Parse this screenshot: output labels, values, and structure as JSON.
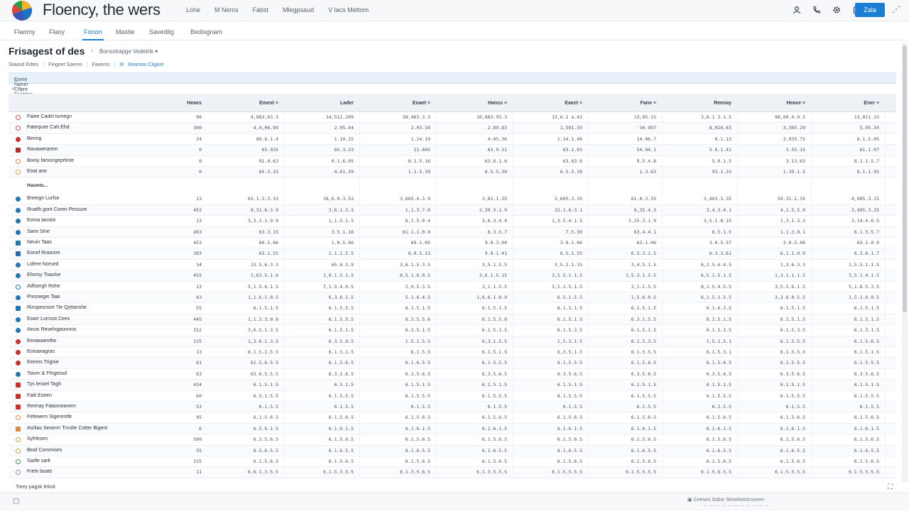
{
  "app": {
    "title": "Floency, the wers",
    "top_menu": [
      "Lohe",
      "Ṁ Nems",
      "Fabst",
      "Mlegpsaud",
      "Ṿ lacs Mettom"
    ],
    "primary_button": "Zala",
    "more_icon": "⋰"
  },
  "icons": {
    "logo": "logo-icon",
    "toolbar": [
      "user-icon",
      "phone-icon",
      "settings-icon",
      "clipboard-icon"
    ]
  },
  "nav": {
    "tabs": [
      "Flaomy",
      "Flaoy",
      "Fonon",
      "Mastie",
      "Saveditg",
      "Bedisgnam"
    ],
    "active_index": 2
  },
  "page": {
    "title": "Frisagest of des",
    "breadcrumb_select": "Bonsolrapge Vedetrik ▾",
    "subbar": [
      "Siawsd Edtes",
      "Fingeet Saeres",
      "Favems",
      "Reamos Cligent"
    ],
    "group_label": "Eome hamer Chpre Faatrtee Mhng",
    "tools": "↶ ↷",
    "section_label": "Hasmts..."
  },
  "table": {
    "columns": [
      "Heaes",
      "Emest ≡",
      "Lader",
      "Eoaet ≡",
      "Hanss ≡",
      "Eaect ≡",
      "Fane ≡",
      "Reenay",
      "Heave ≡",
      "Ener ≡"
    ],
    "group1": [
      {
        "name": "Faiee Cadel tumegn",
        "icon": "ring",
        "color": "#d9534f",
        "values": [
          "96",
          "4,983,63.3",
          "14,511.209",
          "38,463.3.3",
          "10,683.93.3",
          "13,6.1 a.42",
          "13,95.15",
          "3,6.1 2.1.5",
          "98,00.4.9.5",
          "13,011.15"
        ]
      },
      {
        "name": "Faterpuer Cah.Ehd",
        "icon": "ring",
        "color": "#d9534f",
        "values": [
          "300",
          "4,4,06.99",
          "2.05.44",
          "2.03.34",
          "2.89.83",
          "1,501.35",
          "34.997",
          "8,016.63",
          "3,395.29",
          "5,05.34"
        ]
      },
      {
        "name": "Bering",
        "icon": "dot",
        "color": "#c9302c",
        "values": [
          "34",
          "89.6.1.4",
          "1.10.15",
          "1.24.19",
          "4.05.36",
          "1.14.1.46",
          "14.06.7",
          "0.1.13",
          "3.935.75",
          "6.1.5.05"
        ]
      },
      {
        "name": "Ravawerarem",
        "icon": "sq",
        "color": "#b52b27",
        "values": [
          "0",
          "65.935",
          "65.3.33",
          "11.605",
          "63.9.31",
          "63.1.03",
          "54.04.1",
          "5.0.1.41",
          "3.55.15",
          "61.1.07"
        ]
      },
      {
        "name": "Boeiy famongeprtinte",
        "icon": "ring",
        "color": "#e0883c",
        "values": [
          "0",
          "91.0.63",
          "0.1.6.05",
          "8.1.5.16",
          "63.6.1.6",
          "63.63.6",
          "9.5.4.8",
          "5.0.1.5",
          "3.13.63",
          "8.1.1.5.7"
        ]
      },
      {
        "name": "Eoat ane",
        "icon": "ring",
        "color": "#e8a35c",
        "values": [
          "0",
          "65.3.33",
          "4.61.39",
          "1.1.5.39",
          "6.5.5.39",
          "6.5.5.39",
          "1.3.63",
          "93.1.33",
          "1.39.1.5",
          "8.1.1.95"
        ]
      }
    ],
    "group2": [
      {
        "name": "Breeign Lurfse",
        "icon": "dot",
        "color": "#1f77b4",
        "values": [
          "13",
          "63.1.3.3.33",
          "18,6.9.3.53",
          "3,665.4.3.9",
          "3,63.1.35",
          "3,605.3.35",
          "61.0.3.35",
          "3,463.3.35",
          "59.31.1.35",
          "4,905.3.15"
        ]
      },
      {
        "name": "Rnatlh gont Coren Pessure",
        "icon": "dot",
        "color": "#1f77b4",
        "values": [
          "453",
          "8,31.6.3.9",
          "3,6.1.3.3",
          "1,1.3.7.6",
          "2,39.3.1.9",
          "15.1.6.3.1",
          "8,35.4.3",
          "3,4.3.4.1",
          "4,1.5.5.9",
          "3,495.3.35"
        ]
      },
      {
        "name": "Eoma lanstie",
        "icon": "dot",
        "color": "#1f77b4",
        "values": [
          "13",
          "3,3.1.1.9.9",
          "1,1.5.1.5",
          "6,1.5.0.4",
          "3,6.3.4.4",
          "1,3.5.4.1.5",
          "3,15.3.1.9",
          "3,5.1.8.15",
          "1,3.1.3.3",
          "3,14.4.6.5"
        ]
      },
      {
        "name": "Sanx Sine",
        "icon": "dot",
        "color": "#1f77b4",
        "values": [
          "463",
          "63.3.15",
          "3.5.1.16",
          "61.1.1.0.9",
          "6.3.5.7",
          "7.5.39",
          "63.4.4.1",
          "6.5.1.5",
          "1.1.3.9.1",
          "6.1.5.5.7"
        ]
      },
      {
        "name": "Neuin Taas",
        "icon": "sq",
        "color": "#1f77b4",
        "values": [
          "453",
          "60.1.06",
          "1.0.5.06",
          "69.1.05",
          "9.0.3.04",
          "3.0.1.06",
          "63.1.06",
          "3.0.5.57",
          "3.0.5.06",
          "63.1.0.9"
        ]
      },
      {
        "name": "Eonef Rrasnire",
        "icon": "sq",
        "color": "#2a6ab0",
        "values": [
          "303",
          "63.1.55",
          "1.1.1.5.5",
          "6.0.5.13",
          "9.0.1.41",
          "6.5.1.55",
          "6.5.3.1.5",
          "6.3.2.61",
          "6.1.1.0.9",
          "6.3.6.1.7"
        ]
      },
      {
        "name": "Lofere Norsed",
        "icon": "dot",
        "color": "#1f77b4",
        "values": [
          "14",
          "13.5.6.3.3",
          "65.6.3.9",
          "3,6.1.5.3.5",
          "3,5.1.5.5",
          "3,5.1.1.15",
          "3,4.5.1.5",
          "6,1.5.6.4.5",
          "1,3.6.3.3",
          "1,5.5.1.1.5"
        ]
      },
      {
        "name": "Ehorsy Toaslse",
        "icon": "dot",
        "color": "#1f77b4",
        "values": [
          "455",
          "3,63.5.1.6",
          "1,0.1.5.1.5",
          "8,5.1.6.0.5",
          "3,6.1.5.15",
          "3,5.5.1.1.5",
          "1,5.3.1.5.5",
          "6,5.1.5.1.5",
          "1,3.1.1.1.5",
          "3,5.1.4.1.5"
        ]
      },
      {
        "name": "Adfsergh Rohe",
        "icon": "ring",
        "color": "#1f77b4",
        "values": [
          "13",
          "5,1.5.6.1.5",
          "7,1.5.4.0.5",
          "2,0.5.3.5",
          "3,1.1.5.5",
          "3,1.1.5.1.5",
          "3,1.1.5.5",
          "8,1.5.4.5.5",
          "3,5.5.6.1.5",
          "5,1.6.5.3.5"
        ]
      },
      {
        "name": "Presnegin Taai",
        "icon": "dot",
        "color": "#1f77b4",
        "values": [
          "43",
          "1,1.6.1.0.5",
          "6,3.6.1.5",
          "5.1.6.4.5",
          "1,6.6.1.0.9",
          "6.5.1.5.5",
          "1,5.6.0.5",
          "6,1.5.1.5.5",
          "3,3.6.0.5.5",
          "1,5.1.6.0.5"
        ]
      },
      {
        "name": "Rinspesnsre Tie Qyttanshe",
        "icon": "sq",
        "color": "#1f77b4",
        "values": [
          "55",
          "6,1.5.1.5",
          "6.1.5.5.5",
          "6.1.5.1.5",
          "6.1.5.1.5",
          "6.1.3.1.5",
          "6.1.5.1.5",
          "6.1.6.3.5",
          "6.1.5.1.5",
          "6.1.5.1.5"
        ]
      },
      {
        "name": "Eoarr Lurnsst Cees",
        "icon": "dot",
        "color": "#1f77b4",
        "values": [
          "445",
          "1,1.3.3.0.0",
          "6.1.5.5.5",
          "6.3.5.5.6",
          "6.1.5.5.0",
          "6.1.5.1.5",
          "6.3.1.5.5",
          "6.1.5.1.5",
          "6.1.5.1.5",
          "6.1.5.1.5"
        ]
      },
      {
        "name": "Aeuis Revelngaonnnis",
        "icon": "dot",
        "color": "#1f77b4",
        "values": [
          "152",
          "3,6.5.1.3.5",
          "6.1.5.1.5",
          "6.3.5.1.5",
          "6.1.5.1.5",
          "6.1.5.3.5",
          "6.1.5.1.5",
          "6.1.5.1.5",
          "6.1.5.3.5",
          "6.1.3.1.5"
        ]
      },
      {
        "name": "Eerawaenthe",
        "icon": "dot",
        "color": "#c9302c",
        "values": [
          "135",
          "1,3.6.1.3.5",
          "6.3.5.0.5",
          "1.5.1.5.5",
          "6,3.1.5.5",
          "1,5.3.1.5",
          "6.1.5.3.5",
          "1,5.1.5.1",
          "6.1.5.5.5",
          "6.1.5.6.5"
        ]
      },
      {
        "name": "Eoisanagras",
        "icon": "dot",
        "color": "#c9302c",
        "values": [
          "13",
          "6.1.5.1.5.5",
          "6.1.5.1.5",
          "6.1.5.5",
          "6.1.5.1.5",
          "6,3.5.1.5",
          "6.1.5.5.5",
          "6.1.5.3.1",
          "6.1.5.5.5",
          "6.1.5.1.5"
        ]
      },
      {
        "name": "Eeems Trignie",
        "icon": "dot",
        "color": "#c9302c",
        "values": [
          "61",
          "61.5.6.5.5",
          "6.1.5.6.5",
          "6.1.6.5.5",
          "6.1.5.5.5",
          "6.1.5.5.5",
          "6.1.5.6.5",
          "6.1.5.6.5",
          "6.1.5.5.5",
          "6.1.5.5.5"
        ]
      },
      {
        "name": "Tsiorn & Ffngessd",
        "icon": "dot",
        "color": "#1f77b4",
        "values": [
          "63",
          "63.6.5.5.5",
          "6.3.5.6.5",
          "6.3.5.6.5",
          "6.3.5.6.5",
          "6.3.5.6.5",
          "6.3.5.6.5",
          "6.3.5.6.5",
          "6.3.5.6.5",
          "6.3.5.6.5"
        ]
      },
      {
        "name": "Tys lersiel Tagh",
        "icon": "sq",
        "color": "#c9302c",
        "values": [
          "434",
          "6.1.5.1.5",
          "6.5.1.5",
          "6.1.5.1.5",
          "6.1.5.1.5",
          "6.1.5.1.5",
          "6.1.5.1.5",
          "6.1.5.1.5",
          "6.1.5.1.5",
          "6.1.5.1.5"
        ]
      },
      {
        "name": "Faiit Eseen",
        "icon": "sq",
        "color": "#c9302c",
        "values": [
          "60",
          "6.5.1.5.5",
          "6.1.5.5.5",
          "6.1.5.5.5",
          "6.1.5.5.5",
          "6.1.5.5.5",
          "6.1.5.5.5",
          "6.1.5.5.5",
          "6.1.5.5.5",
          "6.1.5.5.5"
        ]
      },
      {
        "name": "Reenay Fatasneanem",
        "icon": "sq",
        "color": "#c9302c",
        "values": [
          "53",
          "6.1.5.5",
          "6.1.5.5",
          "6.1.5.5",
          "6.1.5.5",
          "6.1.5.5",
          "6.1.5.5",
          "6.1.5.5",
          "6.1.5.5",
          "6.1.5.5"
        ]
      },
      {
        "name": "Fefewern Sigerentfe",
        "icon": "ring",
        "color": "#e0883c",
        "values": [
          "95",
          "6,1.5.6.5",
          "6.1.5.6.5",
          "6.1.5.6.5",
          "6.1.5.6.5",
          "6.1.5.6.5",
          "6.1.5.6.5",
          "6.1.5.6.5",
          "6.1.5.6.5",
          "6.1.5.6.5"
        ]
      },
      {
        "name": "Asrlias Sesenrr Trnslte Cotter Bigent",
        "icon": "sq",
        "color": "#e0883c",
        "values": [
          "6",
          "6.5.6.1.5",
          "6.1.6.1.5",
          "6.1.6.1.5",
          "6.1.6.1.5",
          "6.1.6.1.5",
          "6.1.6.1.5",
          "6.1.6.1.5",
          "6.1.6.1.5",
          "6.1.6.1.5"
        ]
      },
      {
        "name": "Syfrlesen",
        "icon": "ring",
        "color": "#c9a93c",
        "values": [
          "500",
          "6.3.5.6.5",
          "6.1.5.6.5",
          "6.1.5.6.5",
          "6.1.5.6.5",
          "6.1.5.6.5",
          "6.1.5.6.5",
          "6.1.5.6.5",
          "6.1.5.6.5",
          "6.1.5.6.5"
        ]
      },
      {
        "name": "Beaf Commises",
        "icon": "ring",
        "color": "#c9a93c",
        "values": [
          "35",
          "6.5.6.5.5",
          "6.1.6.5.5",
          "6.1.6.5.5",
          "6.1.6.5.5",
          "6.1.6.5.5",
          "6.1.6.5.5",
          "6.1.6.5.5",
          "6.1.6.5.5",
          "6.1.6.5.5"
        ]
      },
      {
        "name": "Sadle sark",
        "icon": "ring",
        "color": "#3c9a4c",
        "values": [
          "135",
          "6.1.5.6.5",
          "6.1.5.6.5",
          "6.1.5.6.5",
          "6.1.5.6.5",
          "6.1.5.6.5",
          "6.1.5.6.5",
          "6.1.5.6.5",
          "6.1.5.6.5",
          "6.1.5.6.5"
        ]
      },
      {
        "name": "Fretn boats",
        "icon": "ring",
        "color": "#8a929e",
        "values": [
          "11",
          "6.6.1.3.5.5",
          "6.1.5.3.5.5",
          "6.1.3.5.6.5",
          "6.1.3.5.5.5",
          "6.1.5.5.5.5",
          "6.1.5.5.5.5",
          "6.1.5.6.5.5",
          "6.1.5.5.5.5",
          "6.1.5.5.5.5"
        ]
      }
    ]
  },
  "footer": {
    "note": "Tieey pagsk feksit",
    "status_text": "Ceeses Sobsr Strnelseirtcsxeen",
    "status_sub": "— — — — — — — — — — —"
  }
}
